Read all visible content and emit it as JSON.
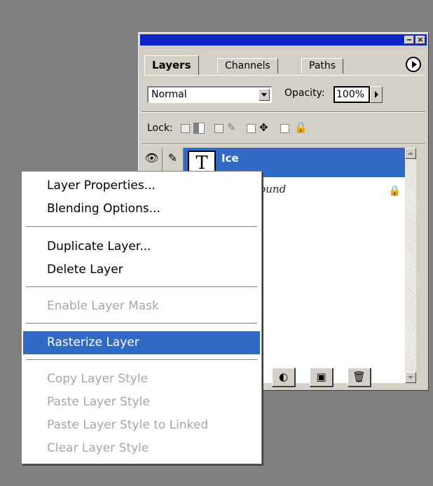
{
  "panel": {
    "tabs": [
      "Layers",
      "Channels",
      "Paths"
    ],
    "blend_mode": "Normal",
    "opacity_label": "Opacity:",
    "opacity_value": "100%",
    "lock_label": "Lock:",
    "layers": [
      {
        "name": "Ice",
        "thumb": "T",
        "selected": true
      },
      {
        "name": "Background",
        "selected": false
      }
    ]
  },
  "context_menu": {
    "items": [
      {
        "label": "Layer Properties...",
        "enabled": true
      },
      {
        "label": "Blending Options...",
        "enabled": true
      },
      {
        "label": "Duplicate Layer...",
        "enabled": true
      },
      {
        "label": "Delete Layer",
        "enabled": true
      },
      {
        "label": "Enable Layer Mask",
        "enabled": false
      },
      {
        "label": "Rasterize Layer",
        "enabled": true,
        "highlighted": true
      },
      {
        "label": "Copy Layer Style",
        "enabled": false
      },
      {
        "label": "Paste Layer Style",
        "enabled": false
      },
      {
        "label": "Paste Layer Style to Linked",
        "enabled": false
      },
      {
        "label": "Clear Layer Style",
        "enabled": false
      }
    ]
  },
  "colors": {
    "desktop": "#808080",
    "titlebar": "#0a24c9",
    "selection": "#316ac5",
    "disabled_text": "#a6a6a6"
  }
}
